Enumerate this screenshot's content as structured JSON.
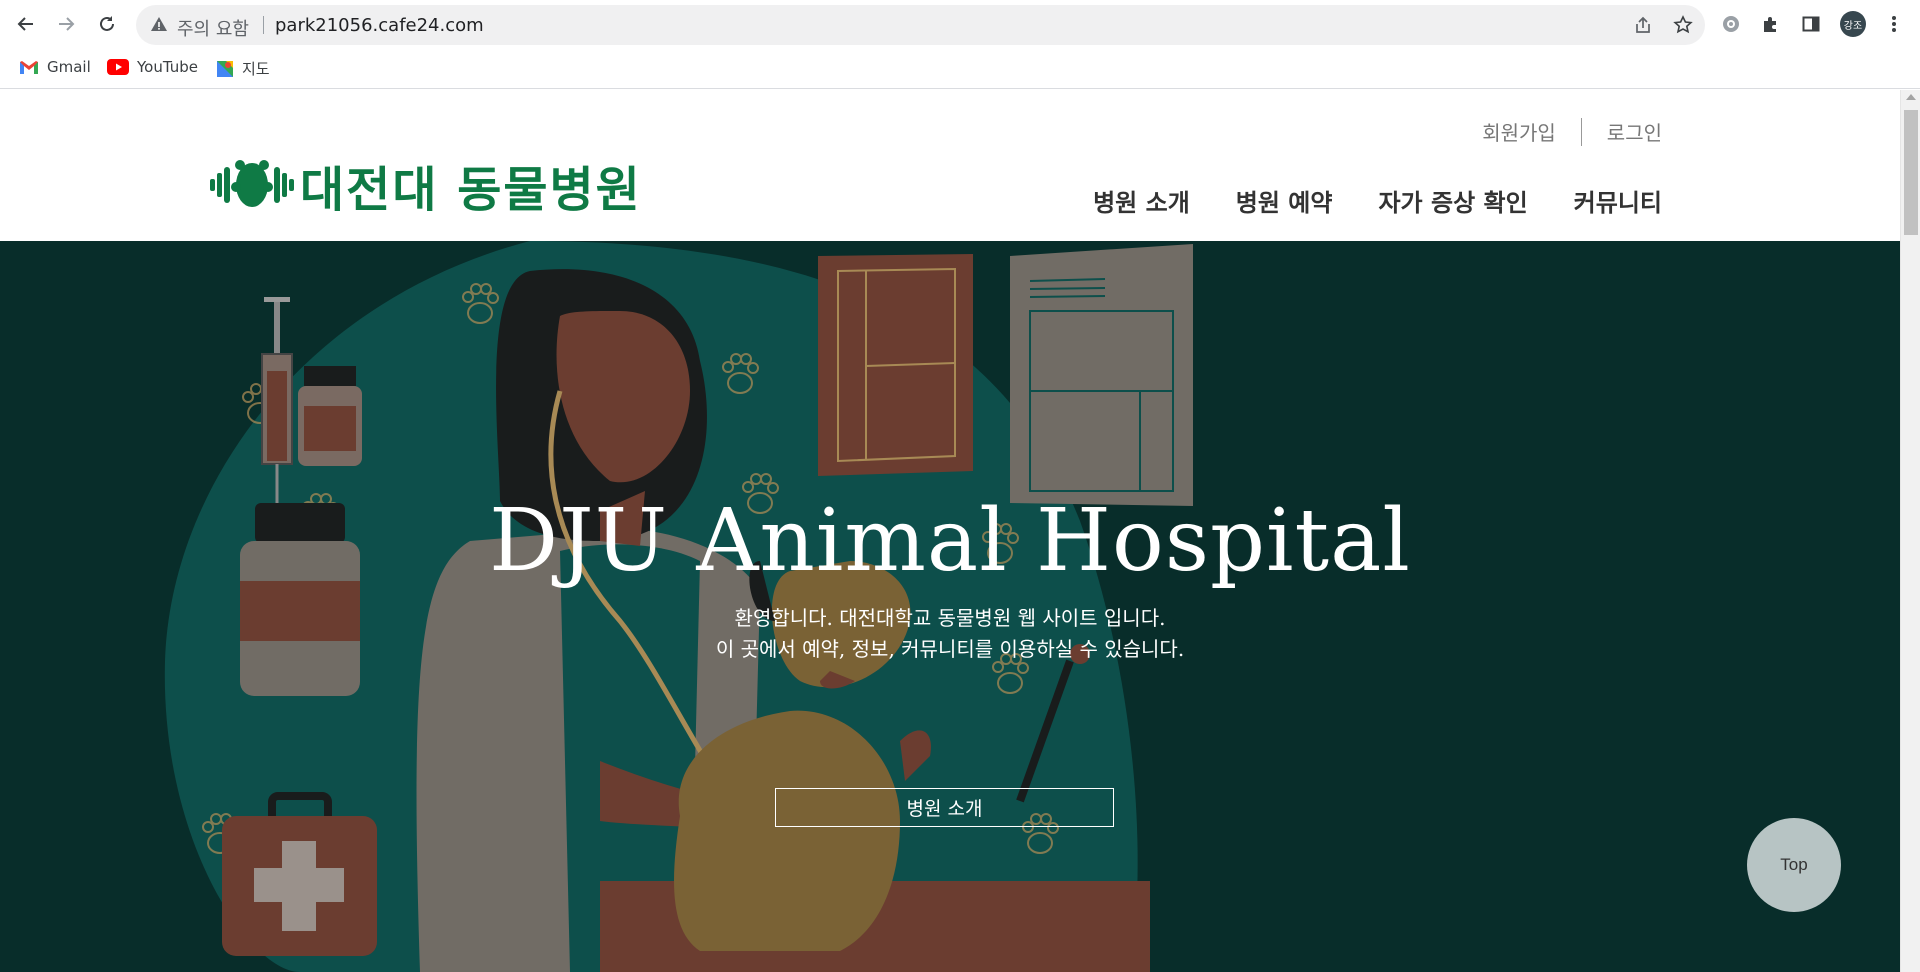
{
  "browser": {
    "security_label": "주의 요함",
    "url": "park21056.cafe24.com",
    "profile_initials": "강조",
    "bookmarks": [
      {
        "label": "Gmail",
        "icon": "gmail-icon"
      },
      {
        "label": "YouTube",
        "icon": "youtube-icon"
      },
      {
        "label": "지도",
        "icon": "maps-icon"
      }
    ]
  },
  "site": {
    "logo_text": "대전대 동물병원",
    "brand_color": "#0f7a45",
    "top_links": {
      "signup": "회원가입",
      "login": "로그인"
    },
    "nav": [
      "병원 소개",
      "병원 예약",
      "자가 증상 확인",
      "커뮤니티"
    ],
    "hero": {
      "title": "DJU Animal Hospital",
      "subtitle_line1": "환영합니다. 대전대학교 동물병원 웹 사이트 입니다.",
      "subtitle_line2": "이 곳에서 예약, 정보, 커뮤니티를 이용하실 수 있습니다.",
      "button_label": "병원 소개",
      "background_color": "#082d2a"
    },
    "top_button": "Top"
  }
}
